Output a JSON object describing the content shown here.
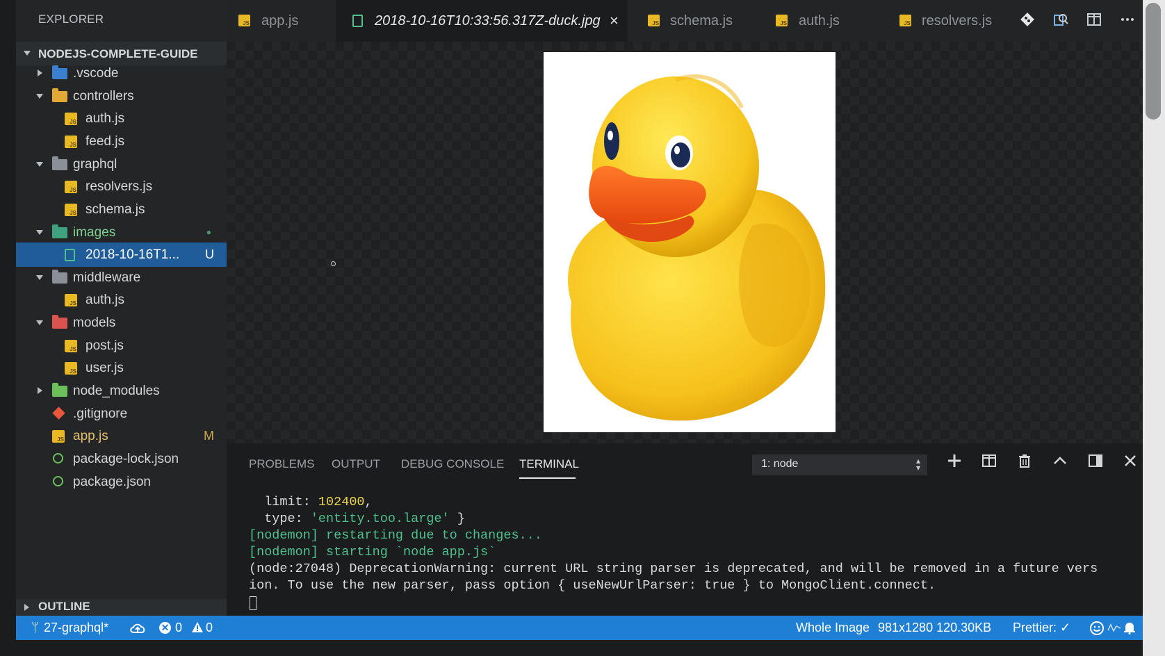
{
  "sidebar": {
    "title": "EXPLORER",
    "project": "NODEJS-COMPLETE-GUIDE",
    "items": [
      {
        "label": ".vscode",
        "icon": "vscode-folder-icon",
        "badge": ""
      },
      {
        "label": "controllers",
        "icon": "controllers-folder-icon",
        "badge": ""
      },
      {
        "label": "auth.js",
        "icon": "js-file-icon",
        "badge": ""
      },
      {
        "label": "feed.js",
        "icon": "js-file-icon",
        "badge": ""
      },
      {
        "label": "graphql",
        "icon": "folder-icon",
        "badge": ""
      },
      {
        "label": "resolvers.js",
        "icon": "js-file-icon",
        "badge": ""
      },
      {
        "label": "schema.js",
        "icon": "js-file-icon",
        "badge": ""
      },
      {
        "label": "images",
        "icon": "images-folder-icon",
        "badge": "●"
      },
      {
        "label": "2018-10-16T1...",
        "icon": "image-file-icon",
        "badge": "U"
      },
      {
        "label": "middleware",
        "icon": "folder-icon",
        "badge": ""
      },
      {
        "label": "auth.js",
        "icon": "js-file-icon",
        "badge": ""
      },
      {
        "label": "models",
        "icon": "models-folder-icon",
        "badge": ""
      },
      {
        "label": "post.js",
        "icon": "js-file-icon",
        "badge": ""
      },
      {
        "label": "user.js",
        "icon": "js-file-icon",
        "badge": ""
      },
      {
        "label": "node_modules",
        "icon": "node-folder-icon",
        "badge": ""
      },
      {
        "label": ".gitignore",
        "icon": "git-icon",
        "badge": ""
      },
      {
        "label": "app.js",
        "icon": "js-file-icon",
        "badge": "M"
      },
      {
        "label": "package-lock.json",
        "icon": "npm-icon",
        "badge": ""
      },
      {
        "label": "package.json",
        "icon": "npm-icon",
        "badge": ""
      }
    ],
    "outline": "OUTLINE"
  },
  "tabs": [
    {
      "label": "app.js",
      "icon": "js-file-icon",
      "active": false
    },
    {
      "label": "2018-10-16T10:33:56.317Z-duck.jpg",
      "icon": "image-file-icon",
      "active": true,
      "close": "×"
    },
    {
      "label": "schema.js",
      "icon": "js-file-icon",
      "active": false
    },
    {
      "label": "auth.js",
      "icon": "js-file-icon",
      "active": false
    },
    {
      "label": "resolvers.js",
      "icon": "js-file-icon",
      "active": false
    }
  ],
  "tab_actions": [
    "git-compare-icon",
    "open-preview-icon",
    "split-editor-icon",
    "more-icon"
  ],
  "panel": {
    "tabs": [
      "PROBLEMS",
      "OUTPUT",
      "DEBUG CONSOLE",
      "TERMINAL"
    ],
    "active_tab": "TERMINAL",
    "terminal_select": "1: node",
    "terminal": {
      "line1_key": "  limit: ",
      "line1_val": "102400",
      "line1_end": ",",
      "line2_key": "  type: ",
      "line2_val": "'entity.too.large'",
      "line2_end": " }",
      "line3": "[nodemon] restarting due to changes...",
      "line4": "[nodemon] starting `node app.js`",
      "line5": "(node:27048) DeprecationWarning: current URL string parser is deprecated, and will be removed in a future vers",
      "line6": "ion. To use the new parser, pass option { useNewUrlParser: true } to MongoClient.connect."
    }
  },
  "statusbar": {
    "branch": "27-graphql*",
    "errors": "0",
    "warnings": "0",
    "zoom": "Whole Image",
    "dimensions": "981x1280 120.30KB",
    "prettier": "Prettier: ✓"
  },
  "colors": {
    "accent": "#1f7fd4",
    "selection": "#1f5c99",
    "js_icon": "#e8b923",
    "terminal_green": "#4fc08d",
    "terminal_yellow": "#e8d44d"
  }
}
